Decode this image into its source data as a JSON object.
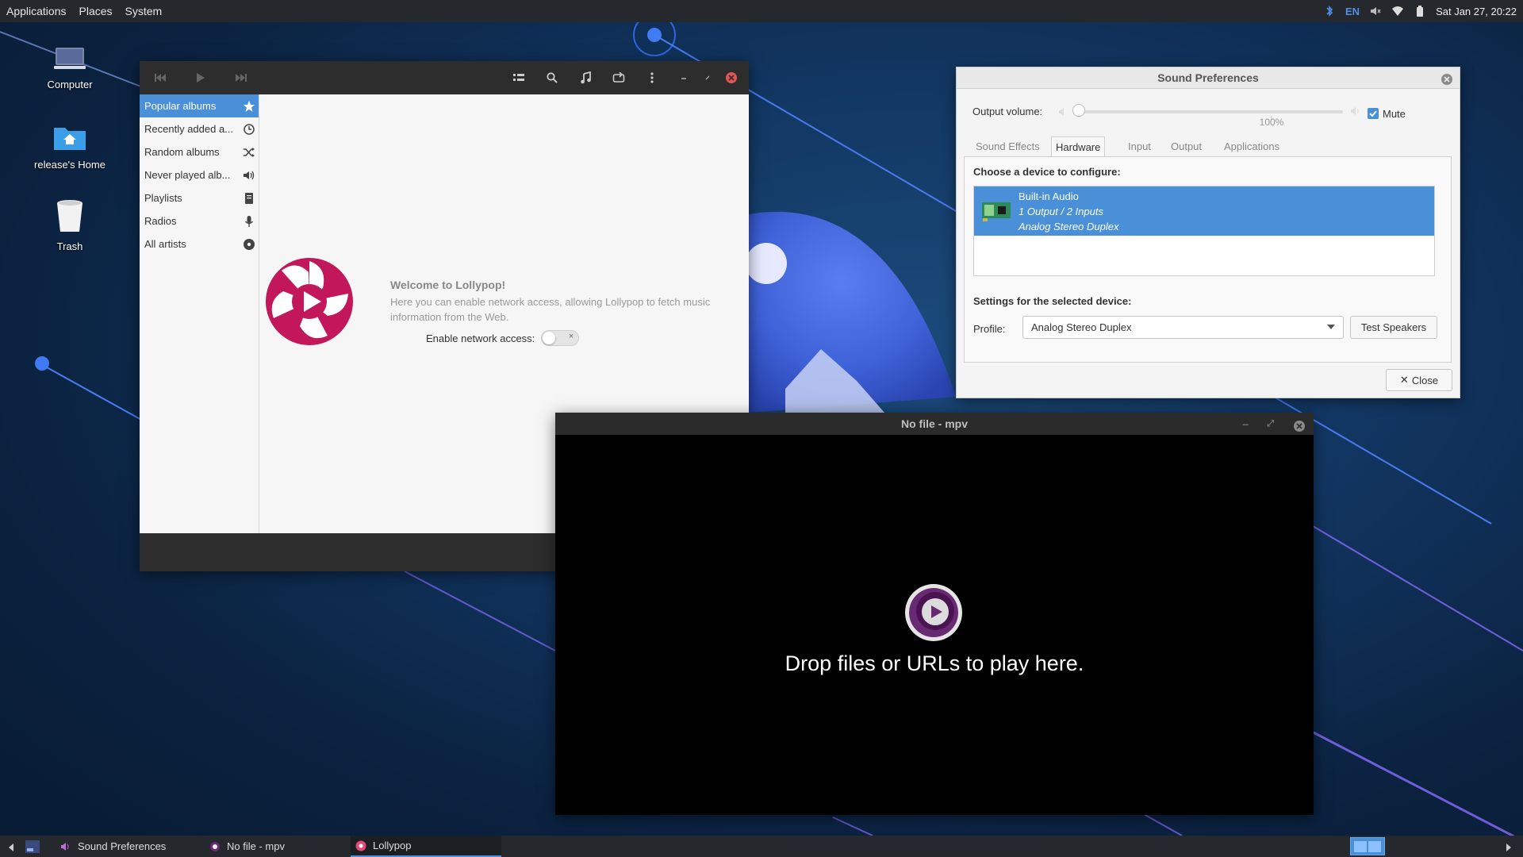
{
  "top_panel": {
    "menus": [
      "Applications",
      "Places",
      "System"
    ],
    "tray": {
      "bluetooth_icon": "bluetooth-icon",
      "keyboard_layout": "EN",
      "volume_icon": "volume-muted-icon",
      "wifi_icon": "wifi-icon",
      "battery_icon": "battery-icon",
      "clock": "Sat Jan 27, 20:22"
    }
  },
  "desktop": {
    "icons": [
      {
        "label": "Computer",
        "icon": "computer-icon"
      },
      {
        "label": "release's Home",
        "icon": "home-folder-icon"
      },
      {
        "label": "Trash",
        "icon": "trash-icon"
      }
    ]
  },
  "lollypop": {
    "sidebar": [
      {
        "label": "Popular albums",
        "icon": "star-icon",
        "active": true
      },
      {
        "label": "Recently added a...",
        "icon": "clock-icon"
      },
      {
        "label": "Random albums",
        "icon": "shuffle-icon"
      },
      {
        "label": "Never played alb...",
        "icon": "speaker-icon"
      },
      {
        "label": "Playlists",
        "icon": "playlist-icon"
      },
      {
        "label": "Radios",
        "icon": "microphone-icon"
      },
      {
        "label": "All artists",
        "icon": "artist-icon"
      }
    ],
    "welcome_title": "Welcome to Lollypop!",
    "welcome_text": "Here you can enable network access, allowing Lollypop to fetch music information from the Web.",
    "network_label": "Enable network access:",
    "network_enabled": false,
    "accent": "#c2185b"
  },
  "sound_prefs": {
    "title": "Sound Preferences",
    "output_volume_label": "Output volume:",
    "volume_percent_label": "100%",
    "volume_level": 0,
    "mute_label": "Mute",
    "mute_checked": true,
    "tabs": [
      "Sound Effects",
      "Hardware",
      "Input",
      "Output",
      "Applications"
    ],
    "active_tab": "Hardware",
    "device_heading": "Choose a device to configure:",
    "device": {
      "name": "Built-in Audio",
      "detail1": "1 Output / 2 Inputs",
      "detail2": "Analog Stereo Duplex"
    },
    "settings_heading": "Settings for the selected device:",
    "profile_label": "Profile:",
    "profile_value": "Analog Stereo Duplex",
    "test_speakers": "Test Speakers",
    "close": "Close",
    "selection_color": "#4a90d9"
  },
  "mpv": {
    "title": "No file - mpv",
    "drop_text": "Drop files or URLs to play here."
  },
  "taskbar": {
    "tasks": [
      {
        "label": "Sound Preferences",
        "icon": "sound-icon"
      },
      {
        "label": "No file - mpv",
        "icon": "mpv-icon"
      },
      {
        "label": "Lollypop",
        "icon": "lollypop-icon",
        "active": true
      }
    ]
  }
}
